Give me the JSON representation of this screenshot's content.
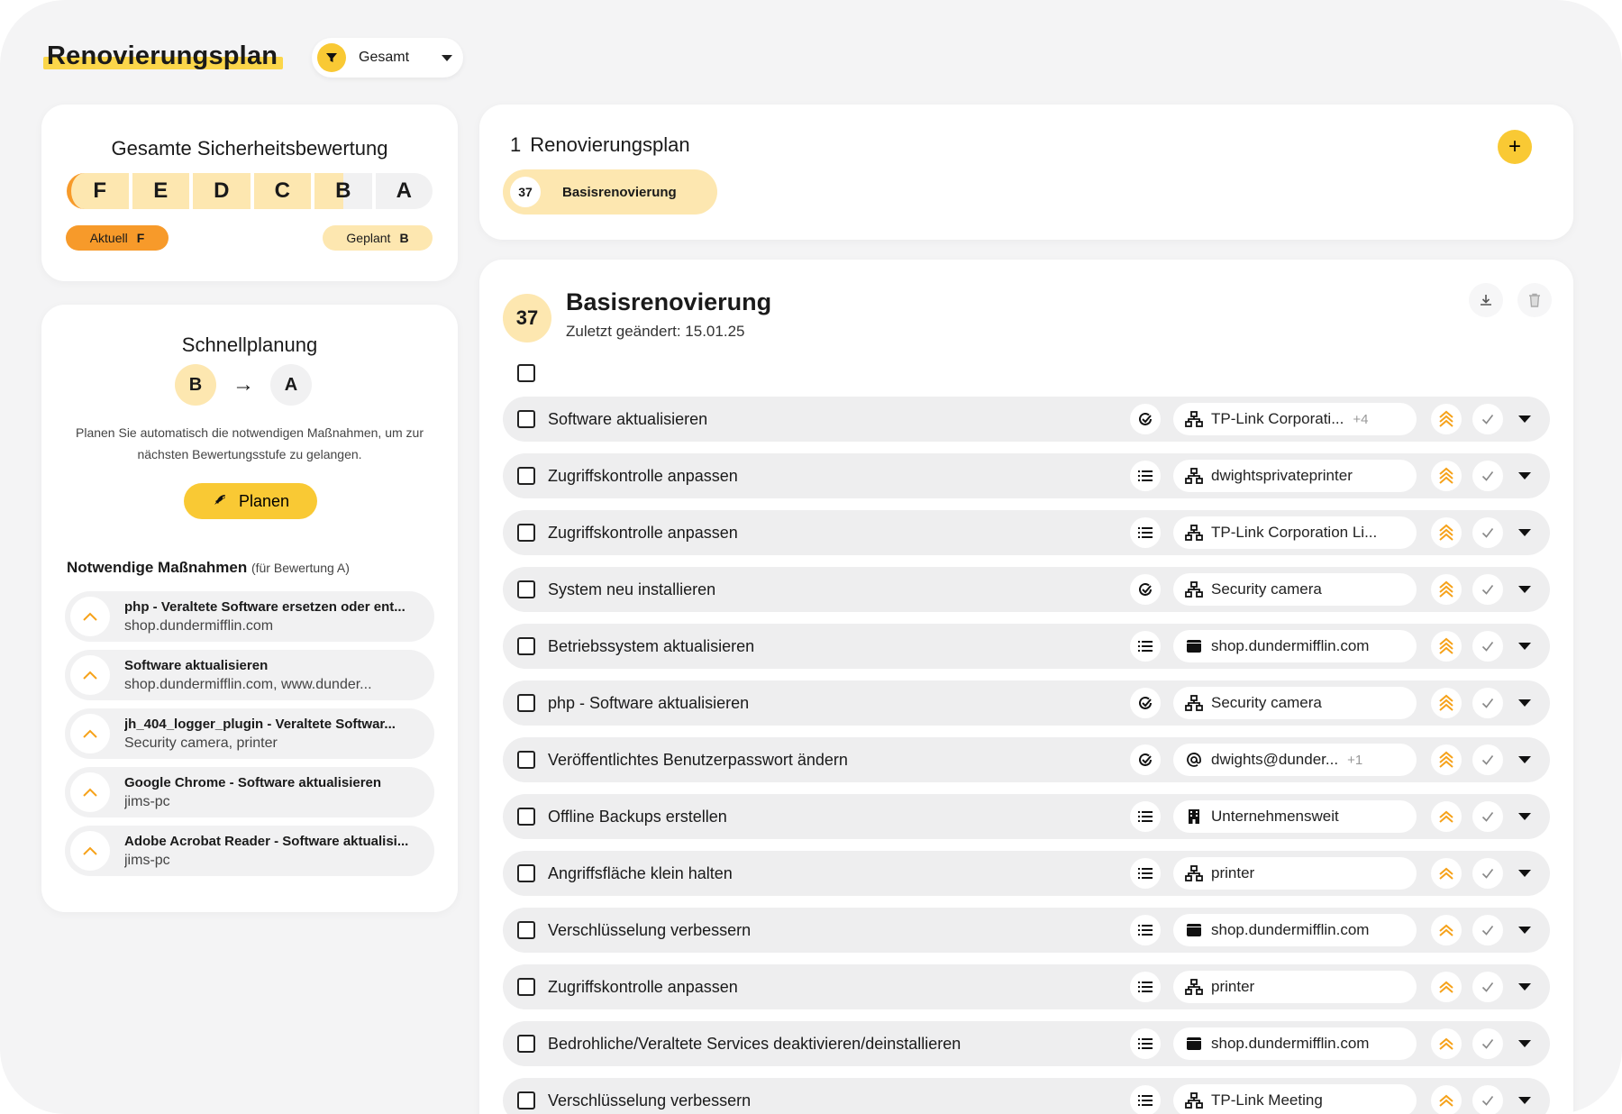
{
  "header": {
    "title": "Renovierungsplan",
    "filter": {
      "value": "Gesamt"
    }
  },
  "rating": {
    "title": "Gesamte Sicherheitsbewertung",
    "grades": [
      "F",
      "E",
      "D",
      "C",
      "B",
      "A"
    ],
    "current_label": "Aktuell",
    "current_grade": "F",
    "planned_label": "Geplant",
    "planned_grade": "B"
  },
  "quick": {
    "title": "Schnellplanung",
    "from": "B",
    "to": "A",
    "description": "Planen Sie automatisch die notwendigen Maßnahmen, um zur nächsten Bewertungsstufe zu gelangen.",
    "button_label": "Planen",
    "measures_title": "Notwendige Maßnahmen",
    "measures_note": "(für Bewertung A)",
    "measures": [
      {
        "title": "php - Veraltete Software ersetzen oder ent...",
        "sub": "shop.dundermifflin.com"
      },
      {
        "title": "Software aktualisieren",
        "sub": "shop.dundermifflin.com, www.dunder..."
      },
      {
        "title": "jh_404_logger_plugin - Veraltete Softwar...",
        "sub": "Security camera, printer"
      },
      {
        "title": "Google Chrome - Software aktualisieren",
        "sub": "jims-pc"
      },
      {
        "title": "Adobe Acrobat Reader - Software aktualisi...",
        "sub": "jims-pc"
      }
    ]
  },
  "plans": {
    "count": "1",
    "heading": "Renovierungsplan",
    "chip_count": "37",
    "chip_label": "Basisrenovierung"
  },
  "detail": {
    "count": "37",
    "title": "Basisrenovierung",
    "subtitle": "Zuletzt geändert: 15.01.25",
    "tasks": [
      {
        "label": "Software aktualisieren",
        "type_icon": "update-icon",
        "asset_icon": "network-icon",
        "asset": "TP-Link Corporati...",
        "extra": "+4",
        "priority_icon": "priority-high-icon"
      },
      {
        "label": "Zugriffskontrolle anpassen",
        "type_icon": "list-icon",
        "asset_icon": "network-icon",
        "asset": "dwightsprivateprinter",
        "extra": "",
        "priority_icon": "priority-high-icon"
      },
      {
        "label": "Zugriffskontrolle anpassen",
        "type_icon": "list-icon",
        "asset_icon": "network-icon",
        "asset": "TP-Link Corporation Li...",
        "extra": "",
        "priority_icon": "priority-high-icon"
      },
      {
        "label": "System neu installieren",
        "type_icon": "update-icon",
        "asset_icon": "network-icon",
        "asset": "Security camera",
        "extra": "",
        "priority_icon": "priority-high-icon"
      },
      {
        "label": "Betriebssystem aktualisieren",
        "type_icon": "list-icon",
        "asset_icon": "web-icon",
        "asset": "shop.dundermifflin.com",
        "extra": "",
        "priority_icon": "priority-high-icon"
      },
      {
        "label": "php - Software aktualisieren",
        "type_icon": "update-icon",
        "asset_icon": "network-icon",
        "asset": "Security camera",
        "extra": "",
        "priority_icon": "priority-high-icon"
      },
      {
        "label": "Veröffentlichtes Benutzerpasswort ändern",
        "type_icon": "update-icon",
        "asset_icon": "at-icon",
        "asset": "dwights@dunder...",
        "extra": "+1",
        "priority_icon": "priority-high-icon"
      },
      {
        "label": "Offline Backups erstellen",
        "type_icon": "list-icon",
        "asset_icon": "building-icon",
        "asset": "Unternehmensweit",
        "extra": "",
        "priority_icon": "priority-medium-icon"
      },
      {
        "label": "Angriffsfläche klein halten",
        "type_icon": "list-icon",
        "asset_icon": "network-icon",
        "asset": "printer",
        "extra": "",
        "priority_icon": "priority-medium-icon"
      },
      {
        "label": "Verschlüsselung verbessern",
        "type_icon": "list-icon",
        "asset_icon": "web-icon",
        "asset": "shop.dundermifflin.com",
        "extra": "",
        "priority_icon": "priority-medium-icon"
      },
      {
        "label": "Zugriffskontrolle anpassen",
        "type_icon": "list-icon",
        "asset_icon": "network-icon",
        "asset": "printer",
        "extra": "",
        "priority_icon": "priority-medium-icon"
      },
      {
        "label": "Bedrohliche/Veraltete Services deaktivieren/deinstallieren",
        "type_icon": "list-icon",
        "asset_icon": "web-icon",
        "asset": "shop.dundermifflin.com",
        "extra": "",
        "priority_icon": "priority-medium-icon"
      },
      {
        "label": "Verschlüsselung verbessern",
        "type_icon": "list-icon",
        "asset_icon": "network-icon",
        "asset": "TP-Link Meeting",
        "extra": "",
        "priority_icon": "priority-medium-icon"
      }
    ]
  },
  "colors": {
    "accent": "#f9c934",
    "accent_light": "#fde7b0",
    "current": "#f79a2a",
    "priority": "#f6a21a"
  }
}
